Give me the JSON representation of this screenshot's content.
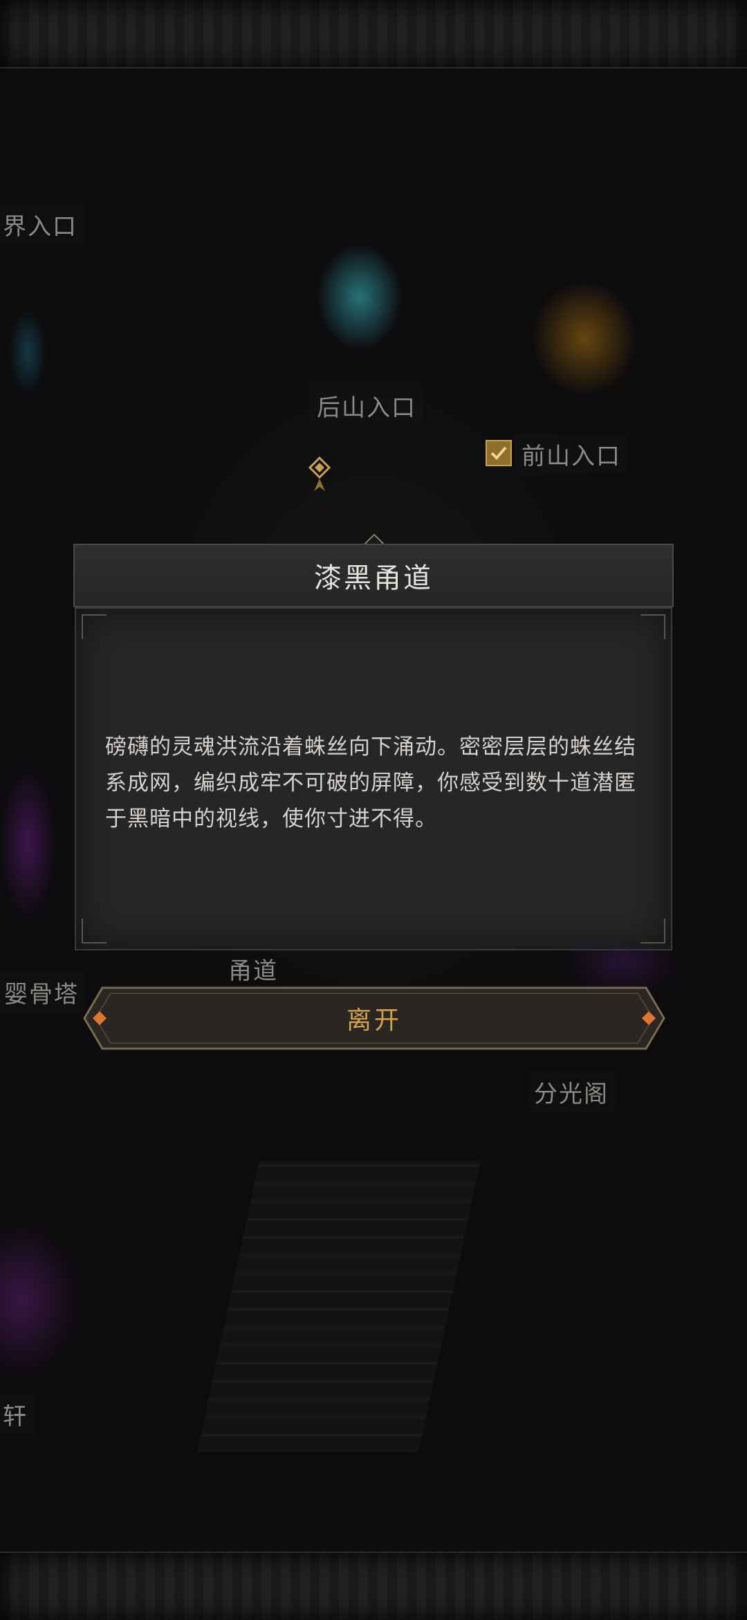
{
  "map": {
    "labels": {
      "realm_entrance": "界入口",
      "back_mountain": "后山入口",
      "front_mountain": "前山入口",
      "tunnel": "甬道",
      "bone_tower": "婴骨塔",
      "split_light_pavilion": "分光阁",
      "pavilion_partial": "轩"
    },
    "icons": {
      "check": "checkbox-checked-icon",
      "location": "location-marker-icon"
    }
  },
  "dialog": {
    "title": "漆黑甬道",
    "description": "磅礴的灵魂洪流沿着蛛丝向下涌动。密密层层的蛛丝结系成网，编织成牢不可破的屏障，你感受到数十道潜匿于黑暗中的视线，使你寸进不得。",
    "leave_label": "离开"
  },
  "colors": {
    "accent_gold": "#d5a04a",
    "portal_cyan": "#3cc8d2",
    "portal_amber": "#d28c14",
    "glow_purple": "#9628be"
  }
}
